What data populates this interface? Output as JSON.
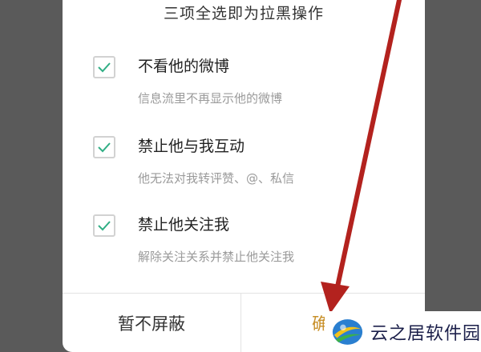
{
  "dialog": {
    "title": "三项全选即为拉黑操作",
    "options": [
      {
        "title": "不看他的微博",
        "desc": "信息流里不再显示他的微博",
        "checked": true
      },
      {
        "title": "禁止他与我互动",
        "desc": "他无法对我转评赞、@、私信",
        "checked": true
      },
      {
        "title": "禁止他关注我",
        "desc": "解除关注关系并禁止他关注我",
        "checked": true
      }
    ],
    "cancel_label": "暂不屏蔽",
    "confirm_label_visible": "确"
  },
  "watermark": {
    "text": "云之居软件园"
  },
  "colors": {
    "overlay": "#5a5a5a",
    "check": "#2fae84",
    "confirm": "#c8902a",
    "arrow": "#b3221e"
  },
  "icons": [
    "checkmark-icon",
    "red-arrow-annotation",
    "site-logo-icon"
  ]
}
